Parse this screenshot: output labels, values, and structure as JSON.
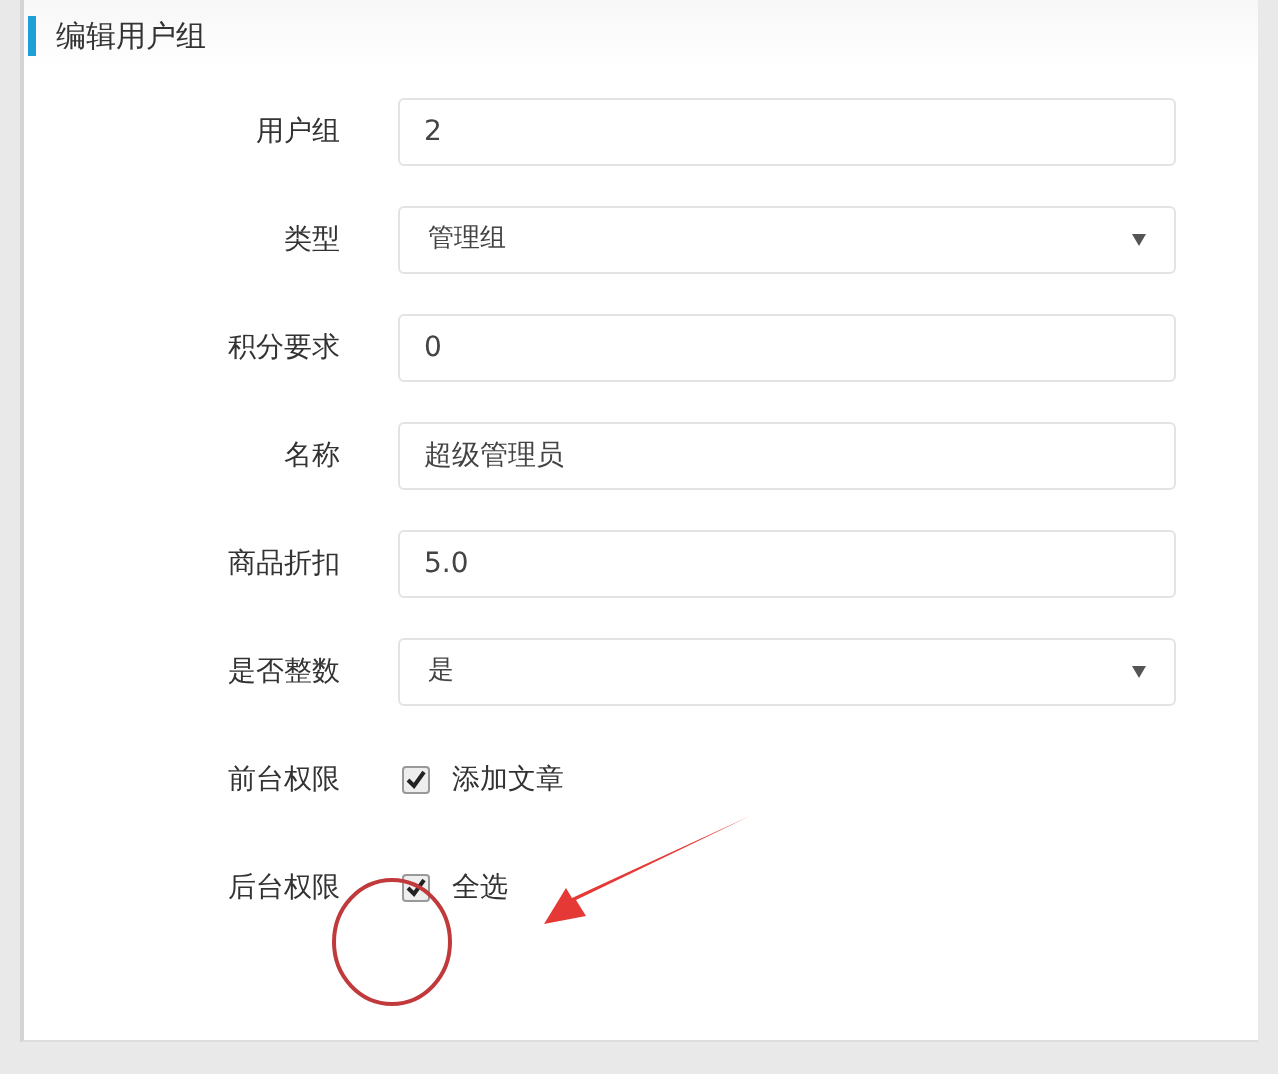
{
  "panel": {
    "title": "编辑用户组"
  },
  "fields": [
    {
      "label": "用户组",
      "kind": "text",
      "value": "2"
    },
    {
      "label": "类型",
      "kind": "select",
      "value": "管理组"
    },
    {
      "label": "积分要求",
      "kind": "text",
      "value": "0"
    },
    {
      "label": "名称",
      "kind": "text",
      "value": "超级管理员"
    },
    {
      "label": "商品折扣",
      "kind": "text",
      "value": "5.0"
    },
    {
      "label": "是否整数",
      "kind": "select",
      "value": "是"
    },
    {
      "label": "前台权限",
      "kind": "checkbox",
      "option": "添加文章",
      "checked": true
    },
    {
      "label": "后台权限",
      "kind": "checkbox",
      "option": "全选",
      "checked": true
    }
  ]
}
